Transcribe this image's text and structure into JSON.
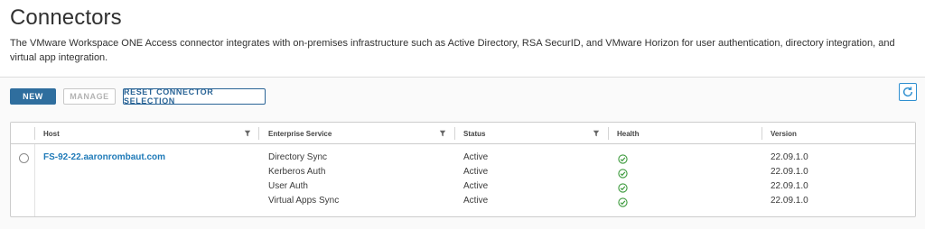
{
  "header": {
    "title": "Connectors",
    "description": "The VMware Workspace ONE Access connector integrates with on-premises infrastructure such as Active Directory, RSA SecurID, and VMware Horizon for user authentication, directory integration, and virtual app integration."
  },
  "toolbar": {
    "new_label": "NEW",
    "manage_label": "MANAGE",
    "reset_label": "RESET CONNECTOR SELECTION"
  },
  "table": {
    "columns": {
      "host": "Host",
      "enterprise_service": "Enterprise Service",
      "status": "Status",
      "health": "Health",
      "version": "Version"
    },
    "host": "FS-92-22.aaronrombaut.com",
    "services": [
      {
        "name": "Directory Sync",
        "status": "Active",
        "health": "healthy",
        "version": "22.09.1.0"
      },
      {
        "name": "Kerberos Auth",
        "status": "Active",
        "health": "healthy",
        "version": "22.09.1.0"
      },
      {
        "name": "User Auth",
        "status": "Active",
        "health": "healthy",
        "version": "22.09.1.0"
      },
      {
        "name": "Virtual Apps Sync",
        "status": "Active",
        "health": "healthy",
        "version": "22.09.1.0"
      }
    ]
  },
  "icons": {
    "refresh": "refresh-icon",
    "filter": "filter-icon",
    "health": "check-circle-icon"
  },
  "colors": {
    "primary": "#2f6e9e",
    "link": "#1f7ab8",
    "healthy": "#3c9a3c"
  }
}
